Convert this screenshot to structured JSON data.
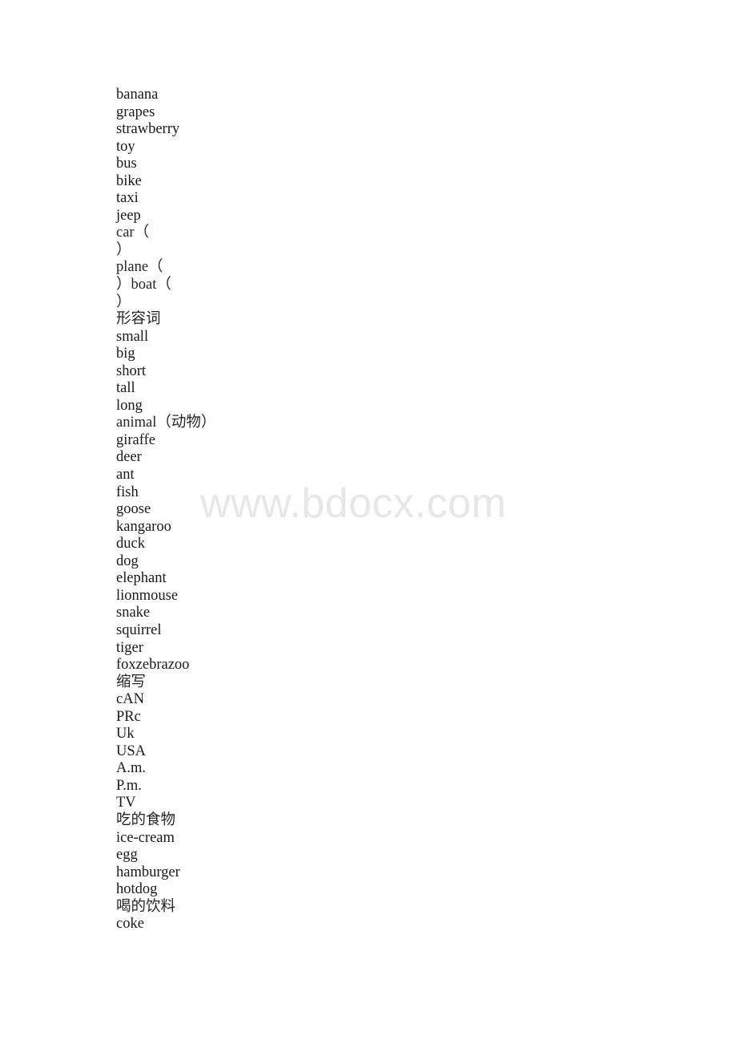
{
  "document": {
    "watermark": "www.bdocx.com",
    "lines": [
      {
        "text": "banana",
        "cjk": false
      },
      {
        "text": "grapes",
        "cjk": false
      },
      {
        "text": "strawberry",
        "cjk": false
      },
      {
        "text": "toy",
        "cjk": false
      },
      {
        "text": "bus",
        "cjk": false
      },
      {
        "text": "bike",
        "cjk": false
      },
      {
        "text": "taxi",
        "cjk": false
      },
      {
        "text": "jeep",
        "cjk": false
      },
      {
        "text": "car（",
        "cjk": true
      },
      {
        "text": "）",
        "cjk": true
      },
      {
        "text": "plane（",
        "cjk": true
      },
      {
        "text": "）boat（",
        "cjk": true
      },
      {
        "text": "）",
        "cjk": true
      },
      {
        "text": "形容词",
        "cjk": true
      },
      {
        "text": "small",
        "cjk": false
      },
      {
        "text": "big",
        "cjk": false
      },
      {
        "text": "short",
        "cjk": false
      },
      {
        "text": "tall",
        "cjk": false
      },
      {
        "text": "long",
        "cjk": false
      },
      {
        "text": "animal（动物）",
        "cjk": true
      },
      {
        "text": "giraffe",
        "cjk": false
      },
      {
        "text": "deer",
        "cjk": false
      },
      {
        "text": "ant",
        "cjk": false
      },
      {
        "text": "fish",
        "cjk": false
      },
      {
        "text": "goose",
        "cjk": false
      },
      {
        "text": "kangaroo",
        "cjk": false
      },
      {
        "text": "duck",
        "cjk": false
      },
      {
        "text": "dog",
        "cjk": false
      },
      {
        "text": "elephant",
        "cjk": false
      },
      {
        "text": "lionmouse",
        "cjk": false
      },
      {
        "text": "snake",
        "cjk": false
      },
      {
        "text": "squirrel",
        "cjk": false
      },
      {
        "text": "tiger",
        "cjk": false
      },
      {
        "text": "foxzebrazoo",
        "cjk": false
      },
      {
        "text": "缩写",
        "cjk": true
      },
      {
        "text": "cAN",
        "cjk": false
      },
      {
        "text": "PRc",
        "cjk": false
      },
      {
        "text": "Uk",
        "cjk": false
      },
      {
        "text": "USA",
        "cjk": false
      },
      {
        "text": "A.m.",
        "cjk": false
      },
      {
        "text": "P.m.",
        "cjk": false
      },
      {
        "text": "TV",
        "cjk": false
      },
      {
        "text": "吃的食物",
        "cjk": true
      },
      {
        "text": "ice-cream",
        "cjk": false
      },
      {
        "text": "egg",
        "cjk": false
      },
      {
        "text": "hamburger",
        "cjk": false
      },
      {
        "text": "hotdog",
        "cjk": false
      },
      {
        "text": "喝的饮料",
        "cjk": true
      },
      {
        "text": "coke",
        "cjk": false
      }
    ]
  }
}
